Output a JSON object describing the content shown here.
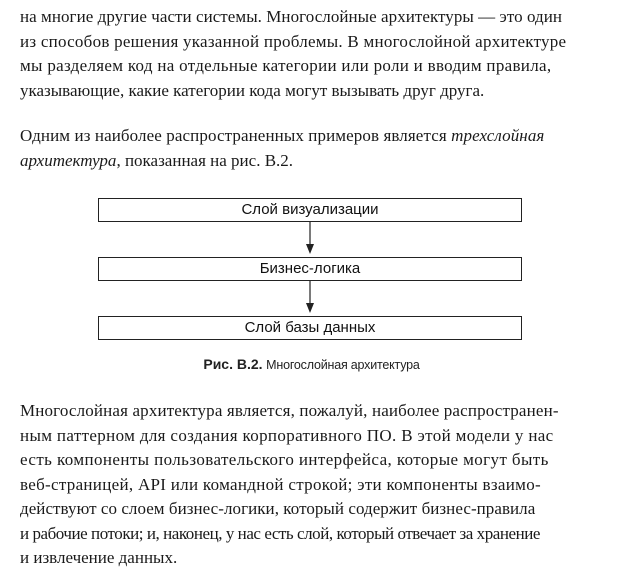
{
  "paragraph1": {
    "lines": [
      "на многие другие части системы. Многослойные архитектуры — это один",
      "из способов решения указанной проблемы. В многослойной архитектуре",
      "мы разделяем код на отдельные категории или роли и вводим правила,",
      "указывающие, какие категории кода могут вызывать друг друга."
    ]
  },
  "paragraph2": {
    "line1_before": "Одним из наиболее распространенных примеров является ",
    "line1_em": "трехслойная",
    "line2_em": "архитектура",
    "line2_after": ", показанная на рис. В.2."
  },
  "figure": {
    "layers": [
      "Слой визуализации",
      "Бизнес-логика",
      "Слой базы данных"
    ],
    "caption_label": "Рис. В.2.",
    "caption_text": "Многослойная архитектура"
  },
  "paragraph3": {
    "lines": [
      "Многослойная архитектура является, пожалуй, наиболее распространен-",
      "ным паттерном для создания корпоративного ПО. В этой модели у нас",
      "есть компоненты пользовательского интерфейса, которые могут быть",
      "веб-страницей, API или командной строкой; эти компоненты взаимо-",
      "действуют со слоем бизнес-логики, который содержит бизнес-правила",
      "и рабочие потоки; и, наконец, у нас есть слой, который отвечает за хранение",
      "и извлечение данных."
    ]
  }
}
